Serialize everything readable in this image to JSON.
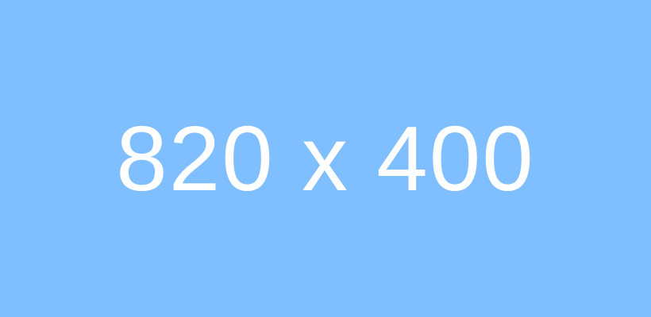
{
  "placeholder": {
    "text": "820 x 400",
    "background_color": "#80BFFF",
    "text_color": "#FFFFFF"
  }
}
